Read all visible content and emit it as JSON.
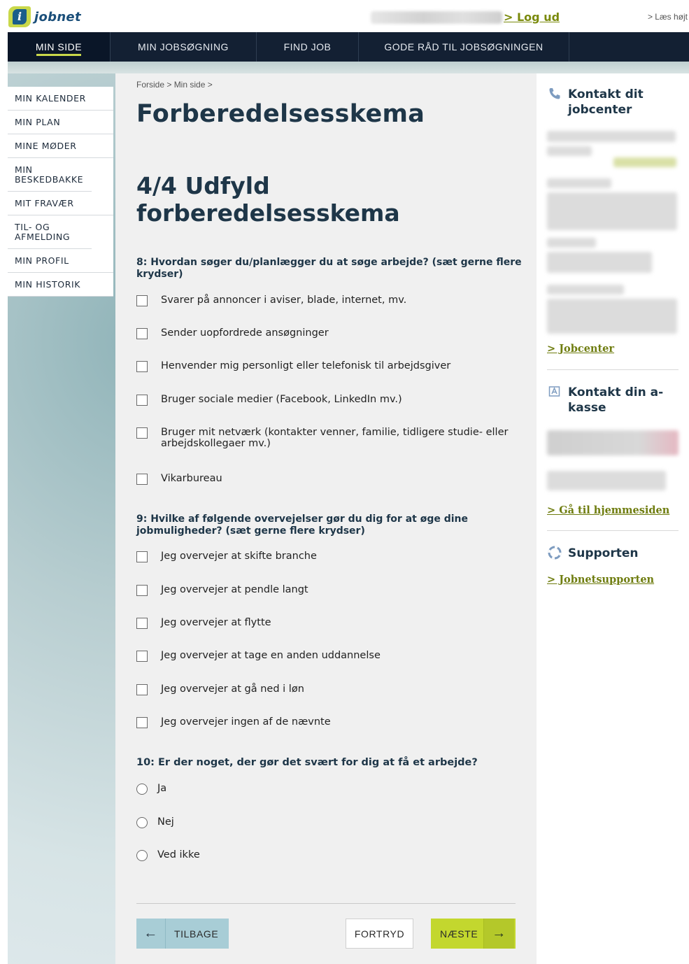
{
  "header": {
    "logo_letter": "i",
    "logo_text": "jobnet",
    "logout_label": "> Log ud",
    "read_aloud_label": "> Læs højt"
  },
  "nav": {
    "items": [
      {
        "label": "MIN SIDE"
      },
      {
        "label": "MIN JOBSØGNING"
      },
      {
        "label": "FIND JOB"
      },
      {
        "label": "GODE RÅD TIL JOBSØGNINGEN"
      }
    ]
  },
  "sidebar": {
    "items": [
      {
        "label": "MIN KALENDER"
      },
      {
        "label": "MIN PLAN"
      },
      {
        "label": "MINE MØDER"
      },
      {
        "label": "MIN BESKEDBAKKE"
      },
      {
        "label": "MIT FRAVÆR"
      },
      {
        "label": "TIL- OG AFMELDING"
      },
      {
        "label": "MIN PROFIL"
      },
      {
        "label": "MIN HISTORIK"
      }
    ]
  },
  "main": {
    "breadcrumb": "Forside > Min side >",
    "page_title": "Forberedelsesskema",
    "section_title": "4/4 Udfyld forberedelsesskema",
    "q8": {
      "label": "8: Hvordan søger du/planlægger du at søge arbejde? (sæt gerne flere krydser)",
      "options": [
        "Svarer på annoncer i aviser, blade, internet, mv.",
        "Sender uopfordrede ansøgninger",
        "Henvender mig personligt eller telefonisk til arbejdsgiver",
        "Bruger sociale medier (Facebook, LinkedIn mv.)",
        "Bruger mit netværk (kontakter venner, familie, tidligere studie- eller arbejdskollegaer mv.)",
        "Vikarbureau"
      ]
    },
    "q9": {
      "label": "9: Hvilke af følgende overvejelser gør du dig for at øge dine jobmuligheder? (sæt gerne flere krydser)",
      "options": [
        "Jeg overvejer at skifte branche",
        "Jeg overvejer at pendle langt",
        "Jeg overvejer at flytte",
        "Jeg overvejer at tage en anden uddannelse",
        "Jeg overvejer at gå ned i løn",
        "Jeg overvejer ingen af de nævnte"
      ]
    },
    "q10": {
      "label": "10: Er der noget, der gør det svært for dig at få et arbejde?",
      "options": [
        "Ja",
        "Nej",
        "Ved ikke"
      ]
    },
    "buttons": {
      "back_label": "TILBAGE",
      "cancel_label": "FORTRYD",
      "next_label": "NÆSTE"
    }
  },
  "right": {
    "jobcenter_title": "Kontakt dit jobcenter",
    "jobcenter_link": "> Jobcenter",
    "akasse_title": "Kontakt din a-kasse",
    "akasse_link": "> Gå til hjemmesiden",
    "support_title": "Supporten",
    "support_link": "> Jobnetsupporten"
  },
  "colors": {
    "nav_bg": "#132033",
    "accent": "#c3d72e",
    "heading": "#1e3648",
    "link": "#6f7d10"
  }
}
